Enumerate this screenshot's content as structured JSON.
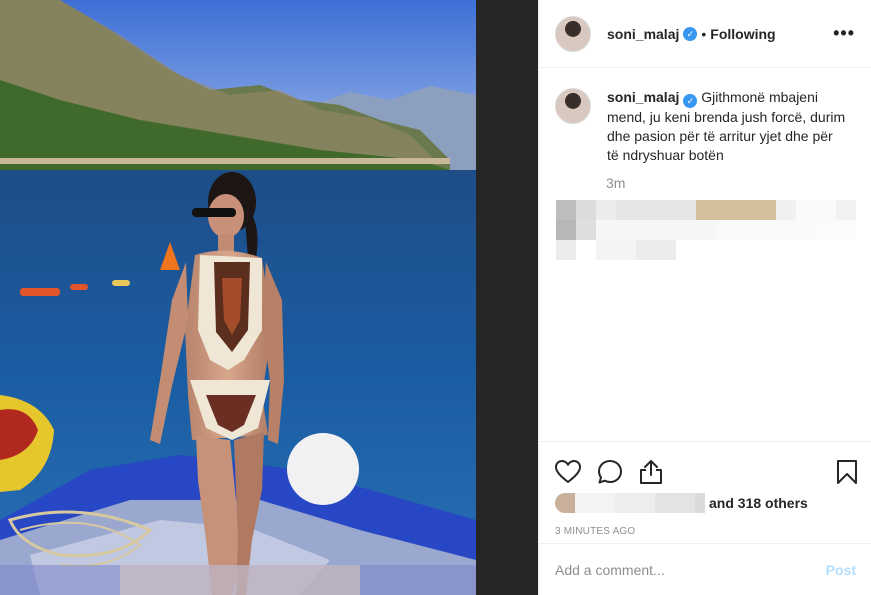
{
  "post": {
    "username": "soni_malaj",
    "verified": true,
    "separator": "•",
    "follow_status": "Following",
    "more_label": "•••",
    "caption": "Gjithmonë mbajeni mend, ju keni brenda jush forcë, durim dhe pasion për të arritur yjet dhe për të ndryshuar botën",
    "caption_time": "3m",
    "likes_text": "and 318 others",
    "posted_ago": "3 MINUTES AGO"
  },
  "icons": {
    "like": "heart-icon",
    "comment": "comment-icon",
    "share": "share-icon",
    "save": "bookmark-icon",
    "verified": "verified-badge-icon",
    "more": "more-options-icon"
  },
  "comment_box": {
    "placeholder": "Add a comment...",
    "post_label": "Post"
  },
  "colors": {
    "accent": "#3897f0",
    "post_disabled": "#b2dffc",
    "muted": "#8e8e8e",
    "gutter": "#262626"
  }
}
